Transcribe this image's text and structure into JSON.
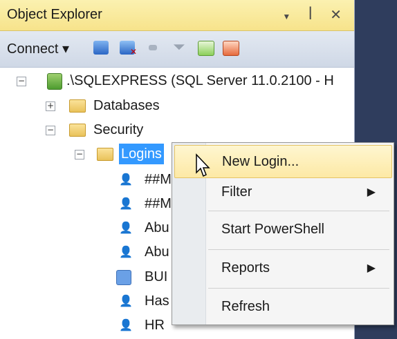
{
  "title_bar": {
    "title": "Object Explorer",
    "controls": "▾ ꟾ ✕"
  },
  "toolbar": {
    "connect_label": "Connect ▾",
    "icons": [
      "connect-object-explorer-icon",
      "disconnect-icon",
      "stop-icon",
      "filter-icon",
      "refresh-icon",
      "activity-monitor-icon"
    ]
  },
  "tree": {
    "server": ".\\SQLEXPRESS (SQL Server 11.0.2100 - H",
    "databases": "Databases",
    "security": "Security",
    "logins": "Logins",
    "login_items": [
      "##M",
      "##M",
      "Abu",
      "Abu",
      "BUI",
      "Has",
      "HR"
    ],
    "expanders": {
      "server": "⊟",
      "databases": "⊞",
      "security": "⊟",
      "logins": "⊟"
    }
  },
  "context_menu": {
    "items": [
      {
        "label": "New Login...",
        "has_submenu": false
      },
      {
        "label": "Filter",
        "has_submenu": true
      },
      {
        "label": "Start PowerShell",
        "has_submenu": false
      },
      {
        "label": "Reports",
        "has_submenu": true
      },
      {
        "label": "Refresh",
        "has_submenu": false
      }
    ],
    "submenu_arrow": "▶"
  },
  "colors": {
    "title_bg": "#f7e38b",
    "highlight": "#3399ff",
    "menu_hover": "#fde9a5",
    "side_strip": "#2f3d5d"
  }
}
